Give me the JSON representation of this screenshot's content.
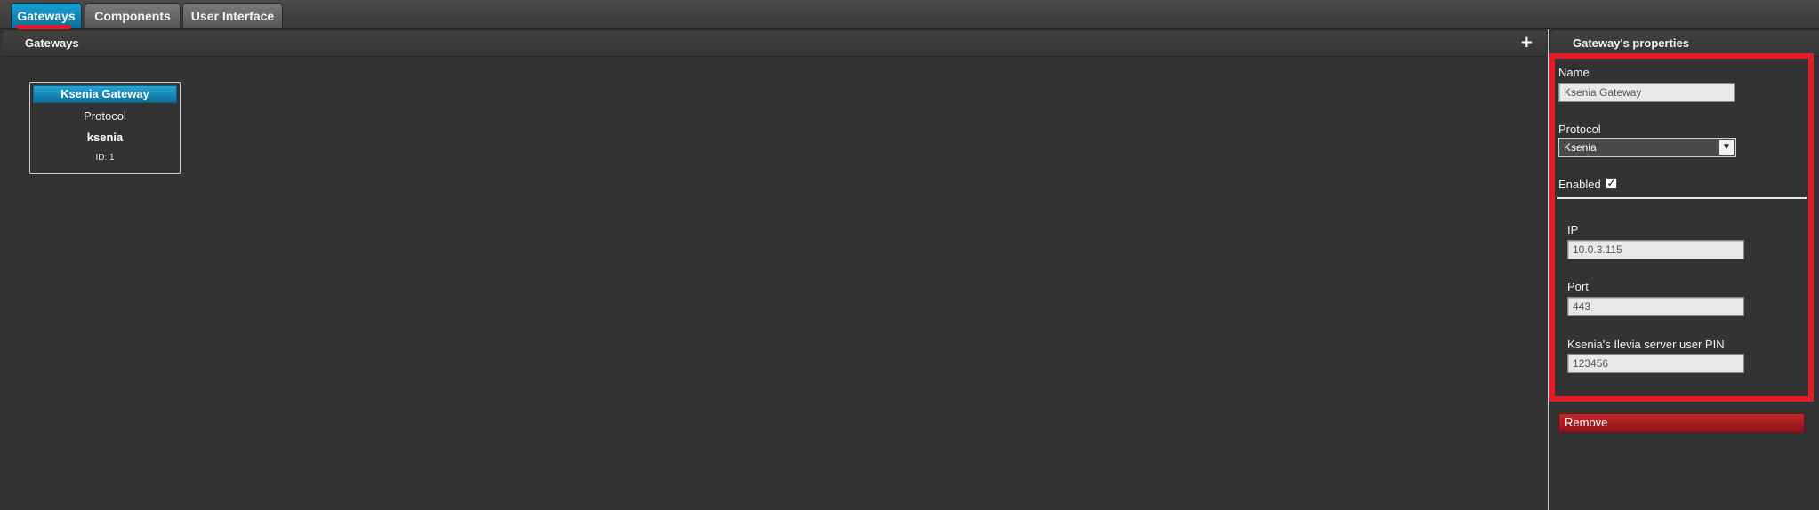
{
  "tabs": [
    {
      "label": "Gateways",
      "active": true
    },
    {
      "label": "Components",
      "active": false
    },
    {
      "label": "User Interface",
      "active": false
    }
  ],
  "main": {
    "title": "Gateways",
    "add_icon": "plus-icon",
    "card": {
      "title": "Ksenia Gateway",
      "protocol_label": "Protocol",
      "protocol_value": "ksenia",
      "id_text": "ID: 1"
    }
  },
  "properties": {
    "title": "Gateway's properties",
    "name_label": "Name",
    "name_value": "Ksenia Gateway",
    "protocol_label": "Protocol",
    "protocol_value": "Ksenia",
    "enabled_label": "Enabled",
    "enabled": true,
    "ip_label": "IP",
    "ip_value": "10.0.3.115",
    "port_label": "Port",
    "port_value": "443",
    "pin_label": "Ksenia's Ilevia server user PIN",
    "pin_value": "123456",
    "remove_label": "Remove"
  },
  "colors": {
    "accent": "#0b89bf",
    "highlight": "#e21b26",
    "remove": "#b01e24"
  }
}
